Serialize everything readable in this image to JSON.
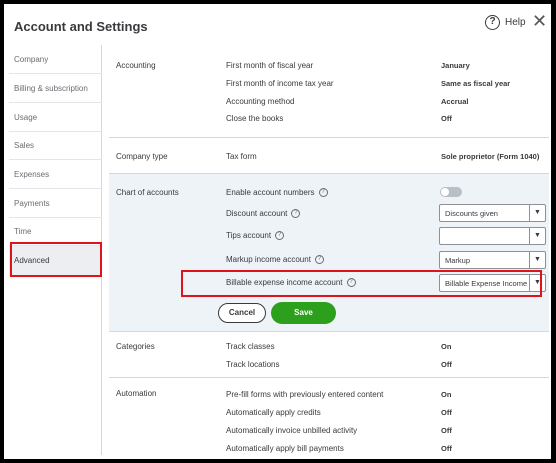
{
  "header": {
    "title": "Account and Settings",
    "help_label": "Help",
    "help_icon": "help-circle-icon",
    "close_icon": "close-icon"
  },
  "sidebar": {
    "items": [
      {
        "label": "Company"
      },
      {
        "label": "Billing & subscription"
      },
      {
        "label": "Usage"
      },
      {
        "label": "Sales"
      },
      {
        "label": "Expenses"
      },
      {
        "label": "Payments"
      },
      {
        "label": "Time"
      },
      {
        "label": "Advanced",
        "active": true
      }
    ]
  },
  "accounting": {
    "title": "Accounting",
    "rows": [
      {
        "label": "First month of fiscal year",
        "value": "January"
      },
      {
        "label": "First month of income tax year",
        "value": "Same as fiscal year"
      },
      {
        "label": "Accounting method",
        "value": "Accrual"
      },
      {
        "label": "Close the books",
        "value": "Off"
      }
    ]
  },
  "company_type": {
    "title": "Company type",
    "label": "Tax form",
    "value": "Sole proprietor (Form 1040)"
  },
  "chart_of_accounts": {
    "title": "Chart of accounts",
    "enable_numbers": {
      "label": "Enable account numbers",
      "enabled": false
    },
    "discount": {
      "label": "Discount account",
      "value": "Discounts given"
    },
    "tips": {
      "label": "Tips account",
      "value": ""
    },
    "markup": {
      "label": "Markup income account",
      "value": "Markup"
    },
    "billable": {
      "label": "Billable expense income account",
      "value": "Billable Expense Income"
    },
    "cancel_label": "Cancel",
    "save_label": "Save"
  },
  "categories": {
    "title": "Categories",
    "rows": [
      {
        "label": "Track classes",
        "value": "On"
      },
      {
        "label": "Track locations",
        "value": "Off"
      }
    ]
  },
  "automation": {
    "title": "Automation",
    "rows": [
      {
        "label": "Pre-fill forms with previously entered content",
        "value": "On"
      },
      {
        "label": "Automatically apply credits",
        "value": "Off"
      },
      {
        "label": "Automatically invoice unbilled activity",
        "value": "Off"
      },
      {
        "label": "Automatically apply bill payments",
        "value": "Off"
      }
    ]
  },
  "colors": {
    "save_green": "#2ca01c",
    "highlight_red": "#e0121c",
    "edit_bg": "#eef3f8"
  }
}
